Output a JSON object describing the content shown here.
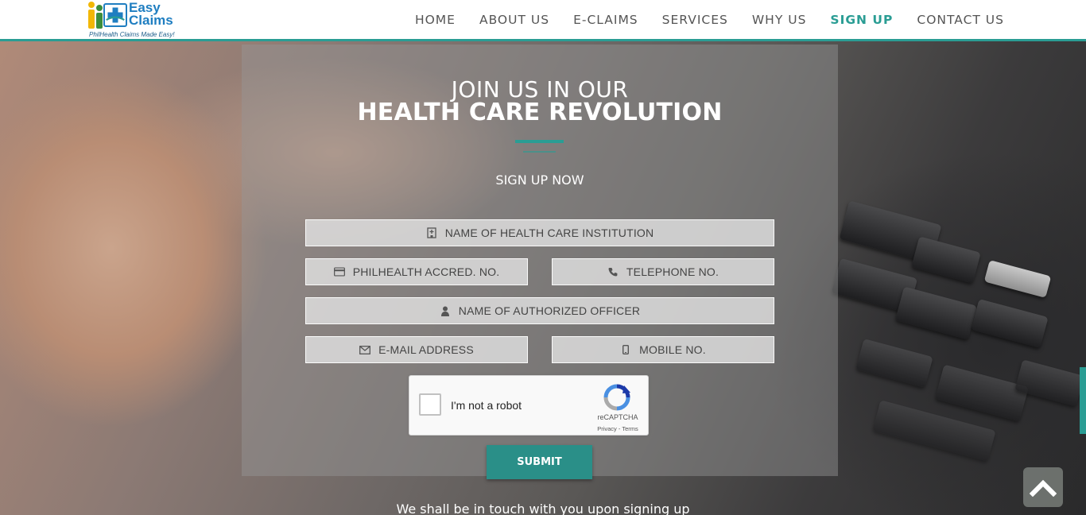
{
  "brand": {
    "name_line1": "Easy",
    "name_line2": "Claims",
    "tagline": "PhilHealth Claims Made Easy!",
    "colors": {
      "primary": "#1f7ec1",
      "accent": "#2a9d94"
    }
  },
  "nav": {
    "items": [
      {
        "label": "HOME",
        "active": false
      },
      {
        "label": "ABOUT US",
        "active": false
      },
      {
        "label": "E-CLAIMS",
        "active": false
      },
      {
        "label": "SERVICES",
        "active": false
      },
      {
        "label": "WHY US",
        "active": false
      },
      {
        "label": "SIGN UP",
        "active": true
      },
      {
        "label": "CONTACT US",
        "active": false
      }
    ]
  },
  "signup": {
    "heading_line1": "JOIN US IN OUR",
    "heading_line2": "HEALTH CARE REVOLUTION",
    "subheading": "SIGN UP NOW",
    "fields": {
      "institution": {
        "placeholder": "NAME OF HEALTH CARE INSTITUTION",
        "icon": "hospital-icon"
      },
      "accreditation": {
        "placeholder": "PHILHEALTH ACCRED. NO.",
        "icon": "credit-card-icon"
      },
      "telephone": {
        "placeholder": "TELEPHONE NO.",
        "icon": "phone-icon"
      },
      "officer": {
        "placeholder": "NAME OF AUTHORIZED OFFICER",
        "icon": "user-icon"
      },
      "email": {
        "placeholder": "E-MAIL ADDRESS",
        "icon": "envelope-icon"
      },
      "mobile": {
        "placeholder": "MOBILE NO.",
        "icon": "mobile-phone-icon"
      }
    },
    "captcha": {
      "label": "I'm not a robot",
      "brand": "reCAPTCHA",
      "links": "Privacy - Terms"
    },
    "submit_label": "SUBMIT",
    "note": "We shall be in touch with you upon signing up"
  },
  "back_to_top": {
    "icon": "chevron-up-icon"
  }
}
